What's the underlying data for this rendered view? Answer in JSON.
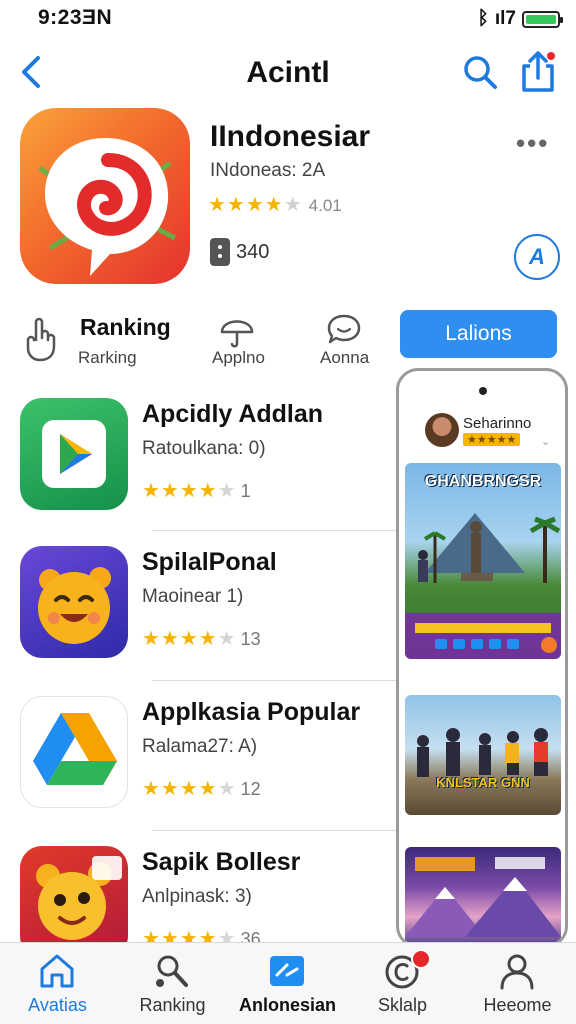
{
  "status_bar": {
    "time": "9:23ƎN",
    "signal_text": "ıl7"
  },
  "nav": {
    "title": "Acintl"
  },
  "featured": {
    "name": "IIndonesiar",
    "subtitle": "INdoneas: 2A",
    "rating_stars": 4,
    "rating_count": "4.01",
    "badge_value": "340",
    "more_label": "•••",
    "round_button_label": "A"
  },
  "categories": {
    "title": "Ranking",
    "items": [
      {
        "label": "Rarking",
        "icon": "hand-icon"
      },
      {
        "label": "Applno",
        "icon": "umbrella-icon"
      },
      {
        "label": "Aonna",
        "icon": "chat-bubble-icon"
      }
    ],
    "primary_button": "Lalions"
  },
  "apps": [
    {
      "name": "Apcidly Addlan",
      "meta": "Ratoulkana: 0)",
      "stars": 3.5,
      "count": "1",
      "icon": "play-store-icon"
    },
    {
      "name": "SpilalPonal",
      "meta": "Maoinear 1)",
      "stars": 4.5,
      "count": "13",
      "icon": "smiley-face-icon"
    },
    {
      "name": "Applkasia Popular",
      "meta": "Ralama27: A)",
      "stars": 4.5,
      "count": "12",
      "icon": "drive-triangle-icon"
    },
    {
      "name": "Sapik Bollesr",
      "meta": "Anlpinask: 3)",
      "stars": 4.5,
      "count": "36",
      "icon": "cartoon-bear-icon"
    }
  ],
  "preview": {
    "profile_name": "Seharinno",
    "profile_stars": "★★★★★",
    "shot1_title": "GHANBRNGSR",
    "shot2_title": "KNLSTAR GNN"
  },
  "tabs": [
    {
      "label": "Avatias",
      "icon": "home-icon",
      "active": true
    },
    {
      "label": "Ranking",
      "icon": "search-person-icon",
      "active": false
    },
    {
      "label": "Anlonesian",
      "icon": "app-grid-icon",
      "active": false,
      "bold": true
    },
    {
      "label": "Sklalp",
      "icon": "copyright-icon",
      "active": false,
      "badge": true
    },
    {
      "label": "Heeome",
      "icon": "person-icon",
      "active": false
    }
  ],
  "colors": {
    "accent": "#1f7ae0",
    "button": "#2f8ef0",
    "star": "#f5b400",
    "badge": "#e6262b"
  }
}
